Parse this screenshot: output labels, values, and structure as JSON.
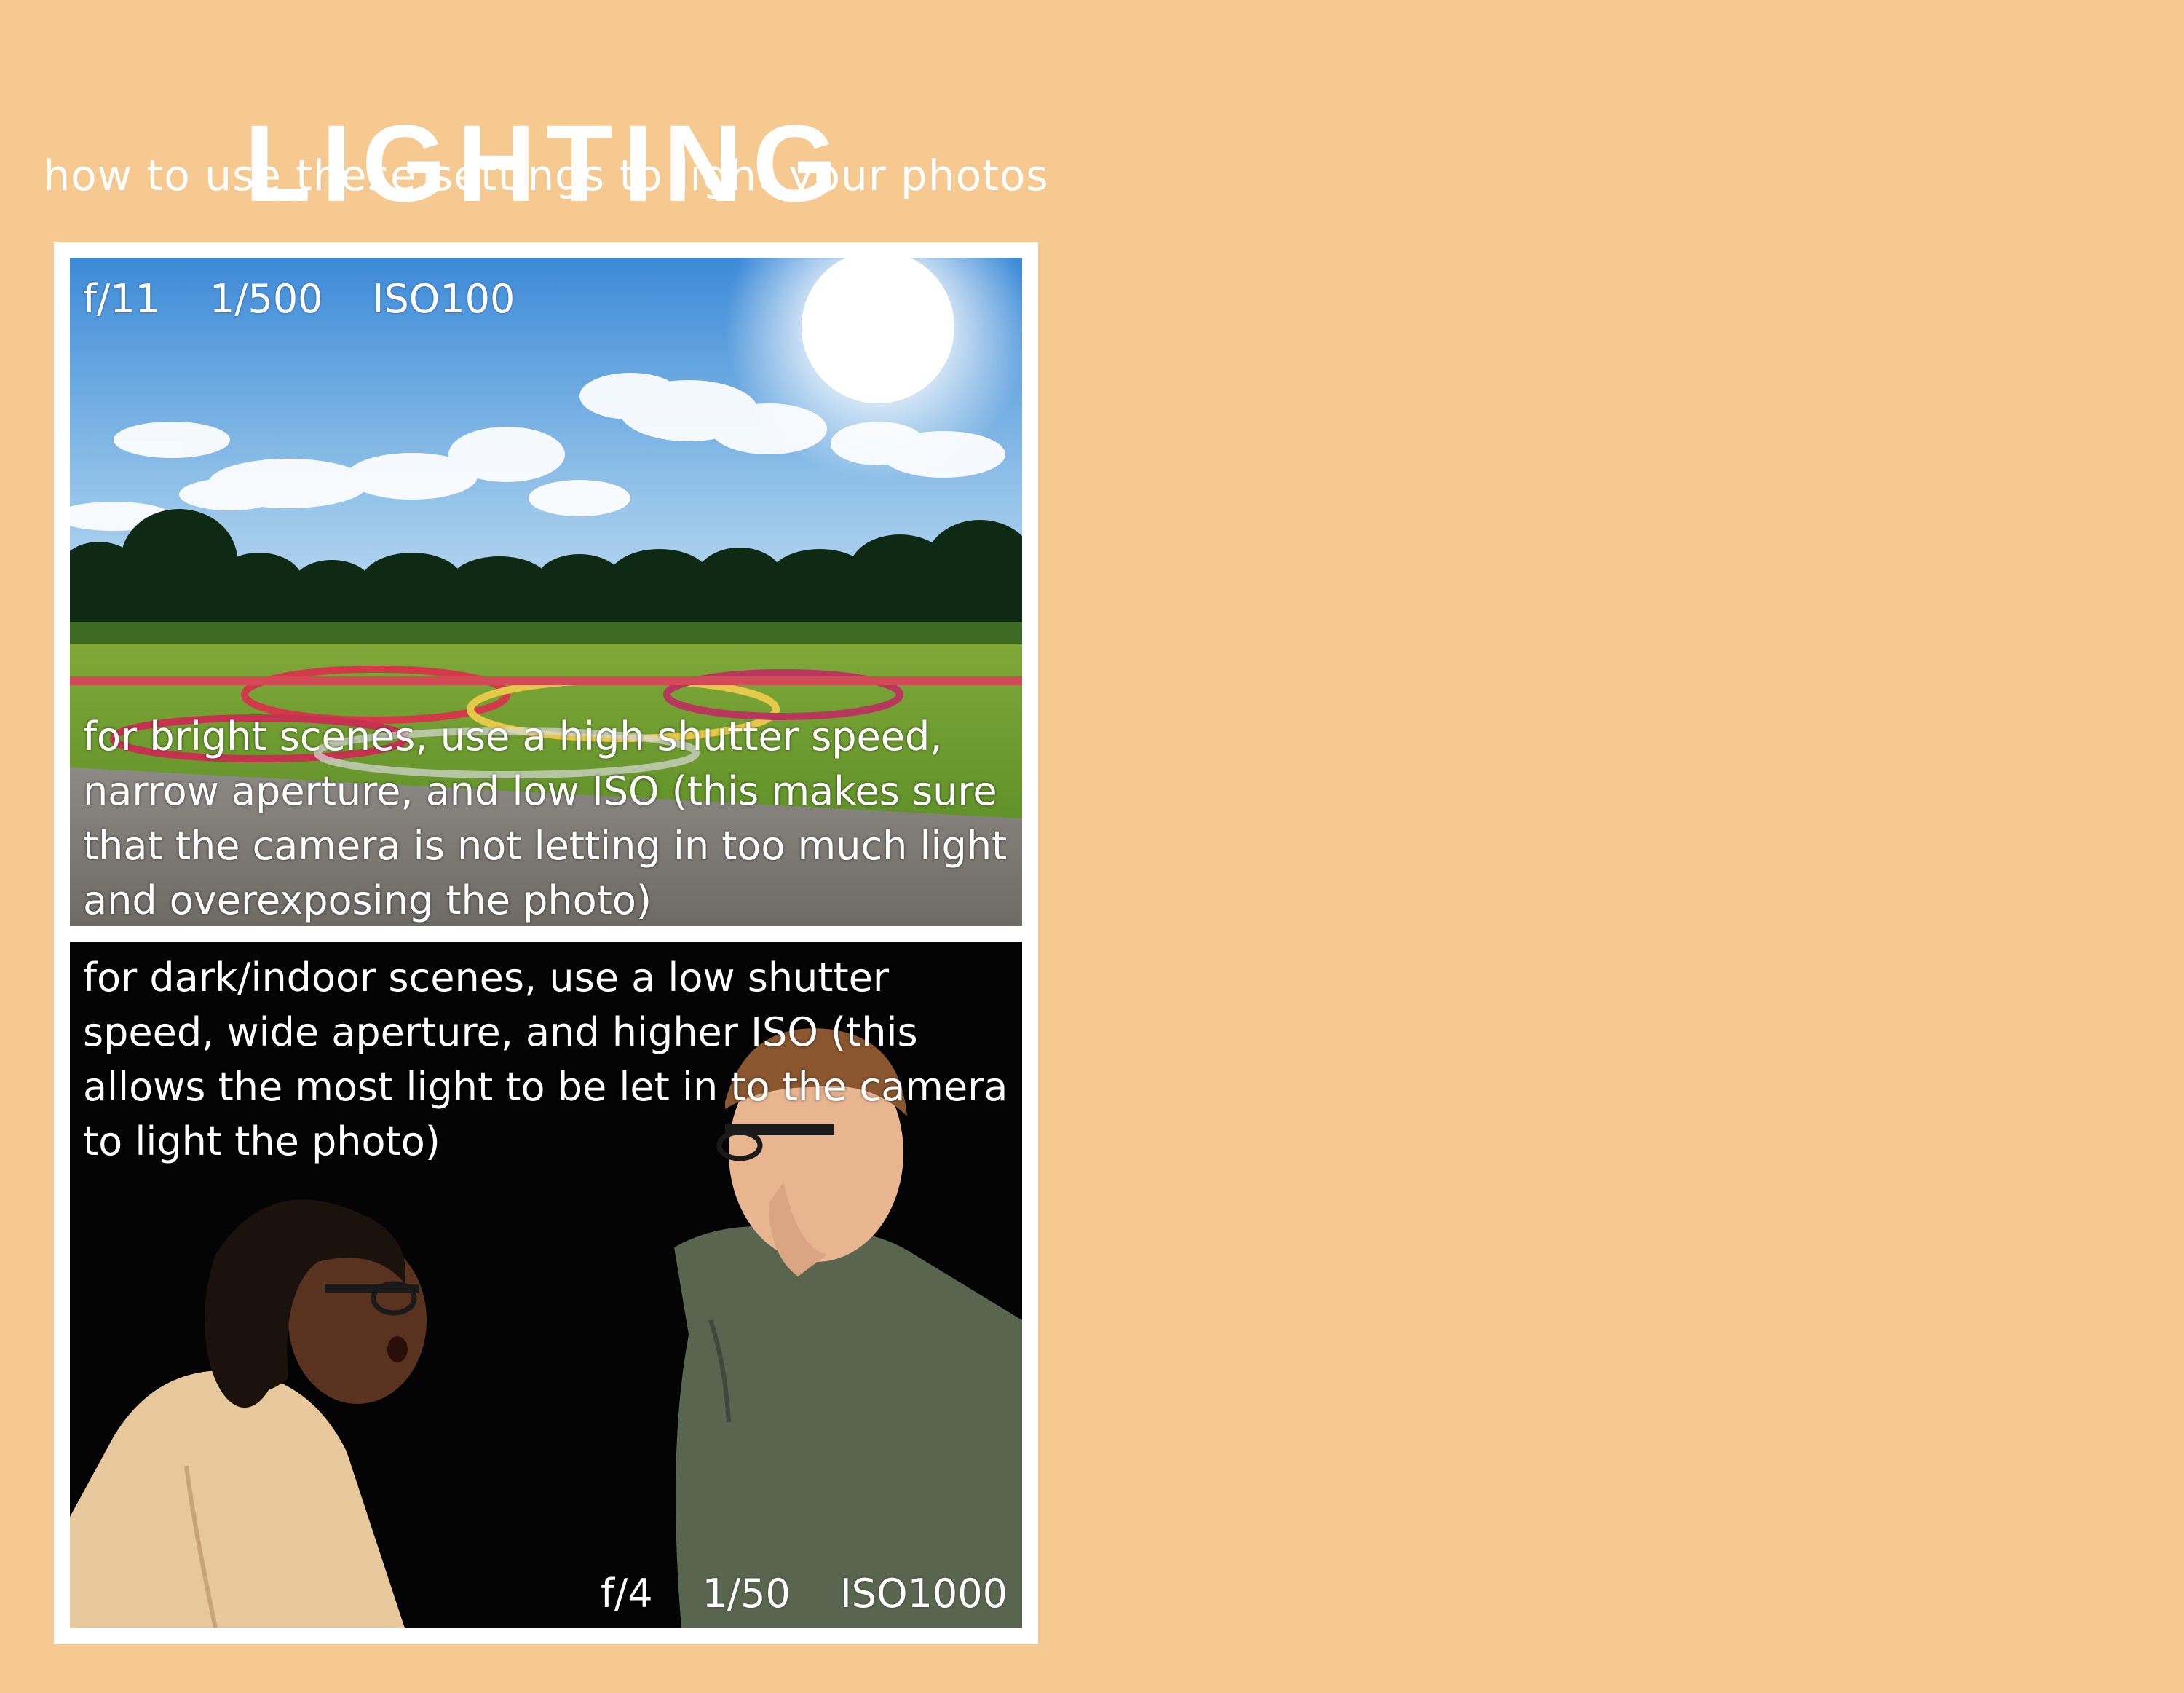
{
  "header": {
    "title": "LIGHTING",
    "subtitle": "how to use these settings to light your photos"
  },
  "bright_example": {
    "aperture": "f/11",
    "shutter": "1/500",
    "iso": "ISO100",
    "caption": "for bright scenes, use a high shutter speed, narrow aperture, and low ISO (this makes sure that the camera is not letting in too much light and overexposing the photo)"
  },
  "dark_example": {
    "aperture": "f/4",
    "shutter": "1/50",
    "iso": "ISO1000",
    "caption": "for dark/indoor scenes, use a low shutter speed, wide aperture, and higher ISO (this allows the most light to be let in to the camera to light the photo)"
  },
  "colors": {
    "page_background": "#f6c990",
    "frame": "#ffffff",
    "text": "#ffffff"
  }
}
